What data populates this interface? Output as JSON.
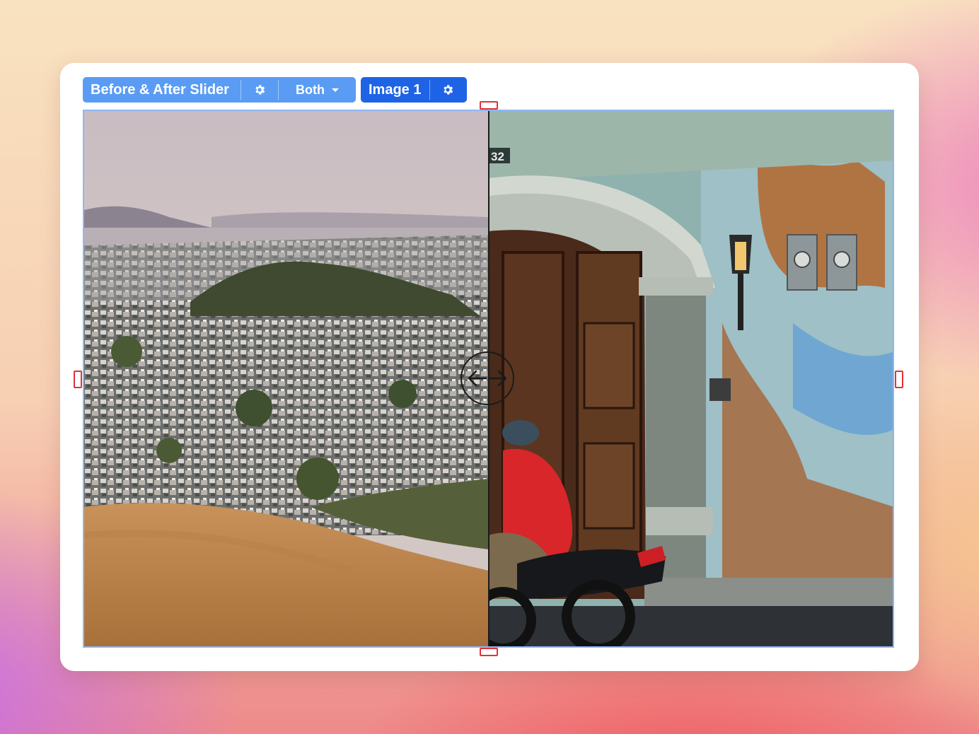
{
  "toolbar": {
    "widget_label": "Before & After Slider",
    "mode_value": "Both",
    "selected_label": "Image 1",
    "widget_icon": "gear-icon",
    "selected_icon": "gear-icon",
    "widget_color": "#5a9cf4",
    "selected_color": "#1e63e6"
  },
  "slider": {
    "position": 0.5,
    "handle_icon": "left-right-arrows-icon",
    "before_image": "city-hillside-photo",
    "after_image": "old-wall-doorway-motorcycle-photo",
    "frame_color": "#8fb6f3",
    "resize_handle_color": "#e0323a"
  },
  "photo_text": {
    "house_number": "32"
  }
}
